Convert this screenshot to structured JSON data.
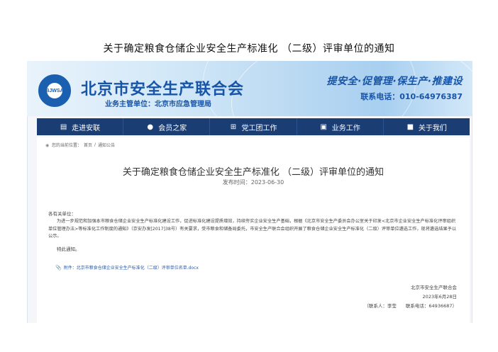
{
  "document": {
    "title": "关于确定粮食仓储企业安全生产标准化 （二级）评审单位的通知"
  },
  "header": {
    "logo_text": "BJWSA",
    "site_name": "北京市安全生产联合会",
    "supervisor": "业务主管单位：北京市应急管理局",
    "slogan": "提安全·促管理·保生产·推建设",
    "phone": "联系电话：010-64976387"
  },
  "nav": {
    "items": [
      {
        "label": "走进安联",
        "icon": "book-icon"
      },
      {
        "label": "会员之家",
        "icon": "users-icon"
      },
      {
        "label": "党工团工作",
        "icon": "org-icon"
      },
      {
        "label": "业务工作",
        "icon": "briefcase-icon"
      },
      {
        "label": "关于我们",
        "icon": "info-icon"
      }
    ]
  },
  "breadcrumb": {
    "prefix": "您的当前位置：",
    "home": "首页",
    "sep": "/",
    "section": "通知公告"
  },
  "article": {
    "title": "关于确定粮食仓储企业安全生产标准化 （二级）评审单位的通知",
    "date": "发布时间：2023-06-30",
    "greeting": "各有关单位：",
    "paragraph": "为进一步规范和加强本市粮食仓储企业安全生产标准化建设工作，促进标准化建设提质增效，持续夯实企业安全生产基础，根据《北京市安全生产委员会办公室关于印发<北京市企业安全生产标准化评审组织单位管理办法>等标准化工作制度的通知》（京安办发[2017]38号）有关要求，受市粮食和储备局委托，市安全生产联合会组织开展了粮食仓储企业安全生产标准化（二级）评审单位遴选工作，现将遴选结果予以公示。",
    "notice": "特此通知。",
    "attachment": "附件：北京市粮食仓储企业安全生产标准化（二级）评审单位名单.docx",
    "sign_org": "北京市安全生产联合会",
    "sign_date": "2023年6月28日",
    "contact": "（联系人：李莹　　联系电话：64936687）"
  }
}
